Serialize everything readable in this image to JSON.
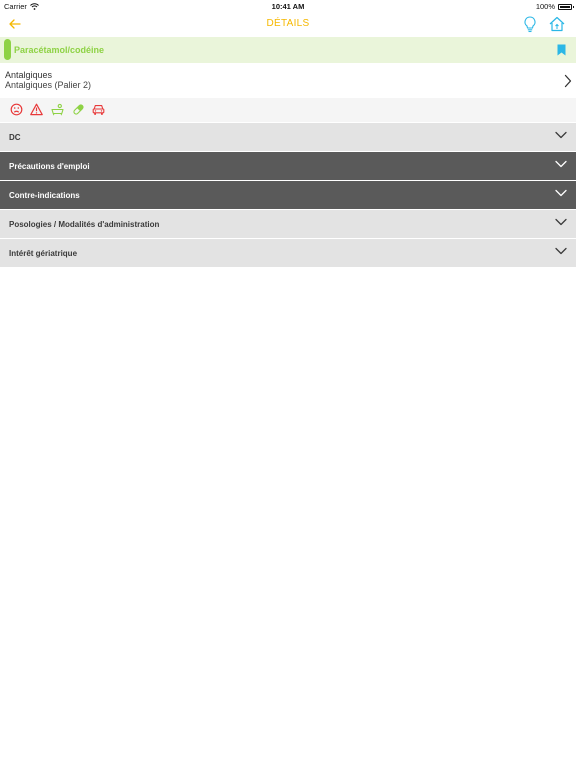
{
  "status_bar": {
    "carrier": "Carrier",
    "time": "10:41 AM",
    "battery": "100%"
  },
  "nav": {
    "title": "DÉTAILS",
    "accent_color": "#f5b800",
    "icon_color": "#2bb7e6",
    "left_icon": "back-arrow-icon",
    "right_icons": [
      "lightbulb-icon",
      "home-icon"
    ]
  },
  "drug": {
    "name": "Paracétamol/codéine",
    "color": "#8ed245",
    "bookmark_icon": "bookmark-icon"
  },
  "class": {
    "title": "Antalgiques",
    "subtitle": "Antalgiques (Palier 2)"
  },
  "warning_icons": [
    {
      "name": "sad-face-icon",
      "color": "#e8393a"
    },
    {
      "name": "warning-triangle-icon",
      "color": "#e8393a"
    },
    {
      "name": "baby-bath-icon",
      "color": "#8ed245"
    },
    {
      "name": "capsule-icon",
      "color": "#8ed245"
    },
    {
      "name": "car-icon",
      "color": "#e8393a"
    }
  ],
  "sections": [
    {
      "label": "DC",
      "style": "light"
    },
    {
      "label": "Précautions d'emploi",
      "style": "dark"
    },
    {
      "label": "Contre-indications",
      "style": "dark"
    },
    {
      "label": "Posologies / Modalités d'administration",
      "style": "light"
    },
    {
      "label": "Intérêt gériatrique",
      "style": "light"
    }
  ]
}
